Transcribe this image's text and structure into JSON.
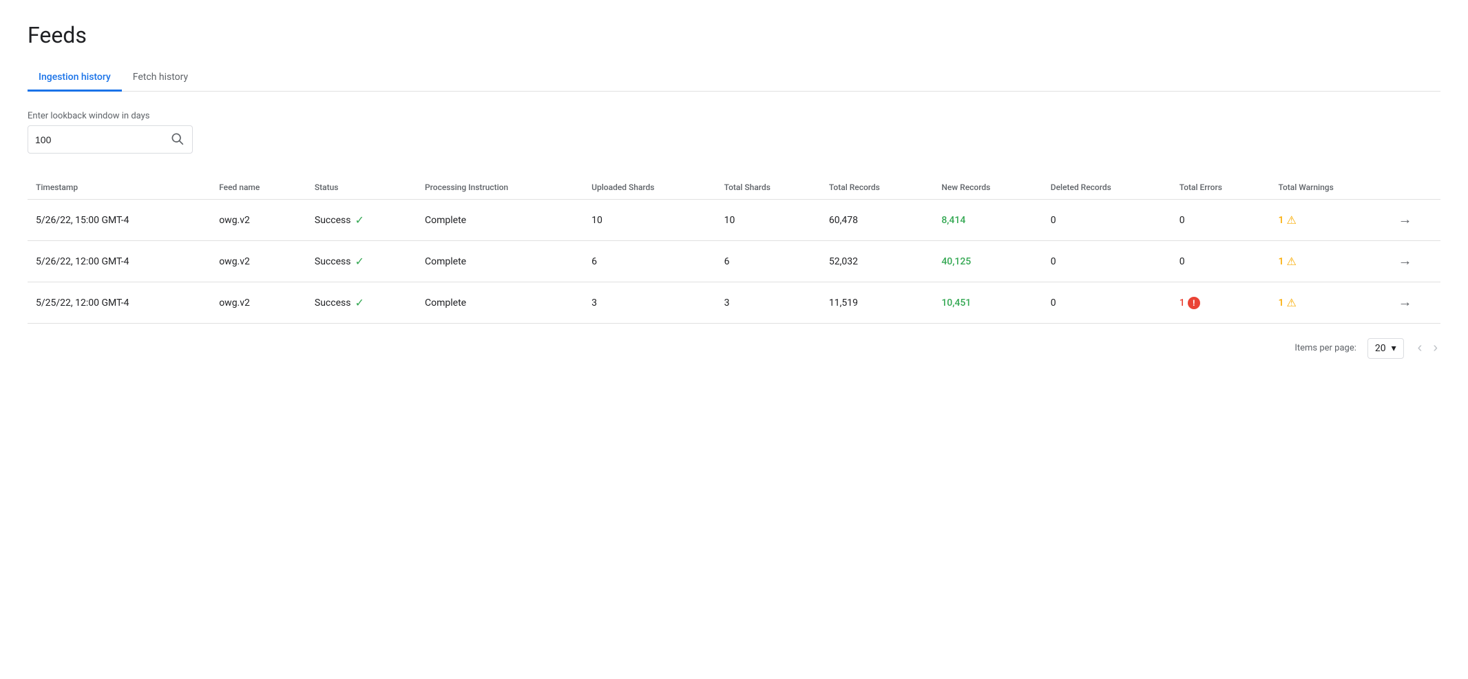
{
  "page": {
    "title": "Feeds"
  },
  "tabs": [
    {
      "id": "ingestion",
      "label": "Ingestion history",
      "active": true
    },
    {
      "id": "fetch",
      "label": "Fetch history",
      "active": false
    }
  ],
  "search": {
    "label": "Enter lookback window in days",
    "value": "100",
    "placeholder": ""
  },
  "table": {
    "columns": [
      {
        "id": "timestamp",
        "label": "Timestamp"
      },
      {
        "id": "feed_name",
        "label": "Feed name"
      },
      {
        "id": "status",
        "label": "Status"
      },
      {
        "id": "processing_instruction",
        "label": "Processing Instruction"
      },
      {
        "id": "uploaded_shards",
        "label": "Uploaded Shards"
      },
      {
        "id": "total_shards",
        "label": "Total Shards"
      },
      {
        "id": "total_records",
        "label": "Total Records"
      },
      {
        "id": "new_records",
        "label": "New Records"
      },
      {
        "id": "deleted_records",
        "label": "Deleted Records"
      },
      {
        "id": "total_errors",
        "label": "Total Errors"
      },
      {
        "id": "total_warnings",
        "label": "Total Warnings"
      }
    ],
    "rows": [
      {
        "timestamp": "5/26/22, 15:00 GMT-4",
        "feed_name": "owg.v2",
        "status": "Success",
        "processing_instruction": "Complete",
        "uploaded_shards": "10",
        "total_shards": "10",
        "total_records": "60,478",
        "new_records": "8,414",
        "new_records_colored": true,
        "deleted_records": "0",
        "total_errors": "0",
        "total_errors_has_icon": false,
        "total_warnings": "1",
        "total_warnings_has_icon": true
      },
      {
        "timestamp": "5/26/22, 12:00 GMT-4",
        "feed_name": "owg.v2",
        "status": "Success",
        "processing_instruction": "Complete",
        "uploaded_shards": "6",
        "total_shards": "6",
        "total_records": "52,032",
        "new_records": "40,125",
        "new_records_colored": true,
        "deleted_records": "0",
        "total_errors": "0",
        "total_errors_has_icon": false,
        "total_warnings": "1",
        "total_warnings_has_icon": true
      },
      {
        "timestamp": "5/25/22, 12:00 GMT-4",
        "feed_name": "owg.v2",
        "status": "Success",
        "processing_instruction": "Complete",
        "uploaded_shards": "3",
        "total_shards": "3",
        "total_records": "11,519",
        "new_records": "10,451",
        "new_records_colored": true,
        "deleted_records": "0",
        "total_errors": "1",
        "total_errors_has_icon": true,
        "total_warnings": "1",
        "total_warnings_has_icon": true
      }
    ]
  },
  "pagination": {
    "items_per_page_label": "Items per page:",
    "items_per_page_value": "20",
    "prev_disabled": true,
    "next_disabled": true
  }
}
